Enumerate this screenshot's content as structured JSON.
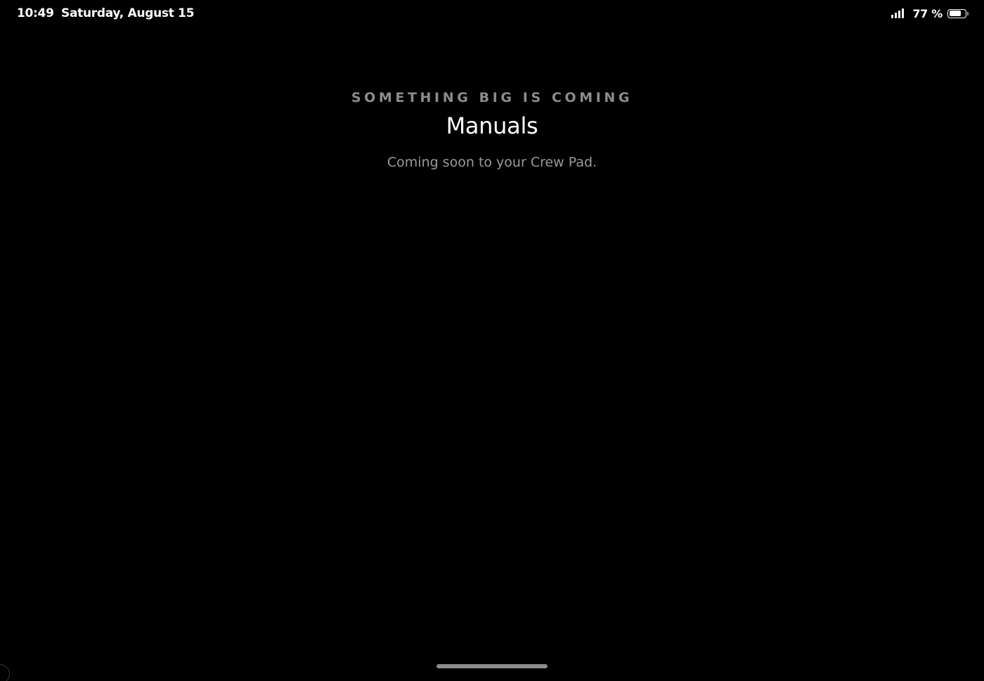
{
  "status_bar": {
    "time": "10:49",
    "date": "Saturday, August 15",
    "battery_percent_label": "77 %",
    "battery_level": 0.77,
    "signal_icon": "cellular-signal-icon",
    "battery_icon": "battery-icon"
  },
  "main": {
    "eyebrow": "SOMETHING BIG IS COMING",
    "title": "Manuals",
    "subtitle": "Coming soon to your Crew Pad."
  },
  "colors": {
    "background": "#000000",
    "text_primary": "#ffffff",
    "text_secondary": "#9a9a9a",
    "eyebrow": "#8c8c8c",
    "home_indicator": "#8a8a8a"
  }
}
